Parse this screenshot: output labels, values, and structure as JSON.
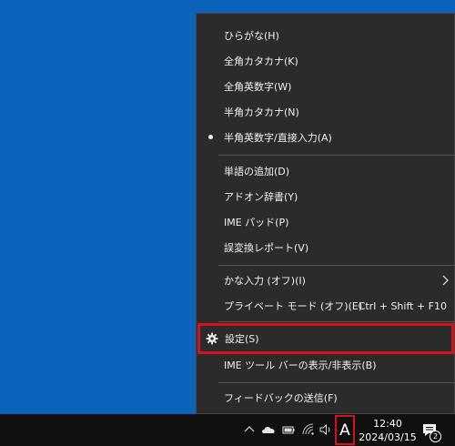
{
  "menu": {
    "items": [
      {
        "label": "ひらがな(H)"
      },
      {
        "label": "全角カタカナ(K)"
      },
      {
        "label": "全角英数字(W)"
      },
      {
        "label": "半角カタカナ(N)"
      },
      {
        "label": "半角英数字/直接入力(A)",
        "selected": true
      },
      {
        "label": "単語の追加(D)"
      },
      {
        "label": "アドオン辞書(Y)"
      },
      {
        "label": "IME パッド(P)"
      },
      {
        "label": "誤変換レポート(V)"
      },
      {
        "label": "かな入力 (オフ)(I)",
        "has_submenu": true
      },
      {
        "label": "プライベート モード (オフ)(E)",
        "shortcut": "Ctrl + Shift + F10"
      },
      {
        "label": "設定(S)",
        "icon": "gear-icon"
      },
      {
        "label": "IME ツール バーの表示/非表示(B)"
      },
      {
        "label": "フィードバックの送信(F)"
      }
    ]
  },
  "taskbar": {
    "ime_mode": "A",
    "time": "12:40",
    "date": "2024/03/15",
    "notification_count": "2",
    "tray_icons": [
      "chevron-up-icon",
      "onedrive-icon",
      "battery-icon",
      "wifi-icon",
      "volume-icon"
    ]
  },
  "colors": {
    "desktop": "#0a63b8",
    "menu_bg": "#2b2b2b",
    "taskbar_bg": "#101010",
    "highlight": "#d3121b"
  }
}
